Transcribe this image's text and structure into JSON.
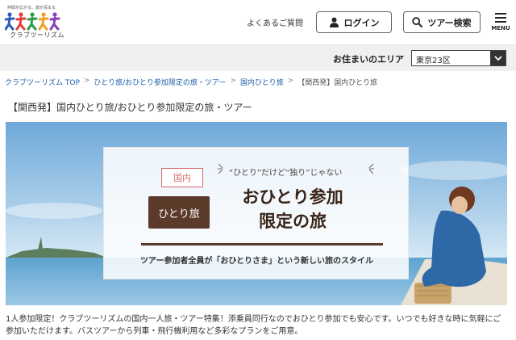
{
  "header": {
    "logo_tagline": "仲間が広がる、旅が深まる",
    "logo_name": "クラブツーリズム",
    "faq_label": "よくあるご質問",
    "login_label": "ログイン",
    "search_label": "ツアー検索",
    "menu_label": "MENU"
  },
  "area": {
    "label": "お住まいのエリア",
    "selected": "東京23区"
  },
  "breadcrumb": {
    "items": [
      "クラブツーリズム TOP",
      "ひとり旅/おひとり参加限定の旅・ツアー",
      "国内ひとり旅",
      "【関西発】国内ひとり旅"
    ],
    "separator": ">"
  },
  "page_title": "【関西発】国内ひとり旅/おひとり参加限定の旅・ツアー",
  "banner": {
    "badge_domestic": "国内",
    "badge_solo": "ひとり旅",
    "catchphrase": "“ひとり”だけど“独り”じゃない",
    "headline_line1": "おひとり参加",
    "headline_line2": "限定の旅",
    "subtitle": "ツアー参加者全員が「おひとりさま」という新しい旅のスタイル"
  },
  "description": "1人参加限定！クラブツーリズムの国内一人旅・ツアー特集！添乗員同行なのでおひとり参加でも安心です。いつでも好きな時に気軽にご参加いただけます。バスツアーから列車・飛行機利用など多彩なプランをご用意。",
  "colors": {
    "accent_brown": "#5b3a2a",
    "badge_red": "#d76b6b",
    "link_blue": "#1d5fa8",
    "sky_blue": "#7fb6df"
  },
  "icons": {
    "login": "user-icon",
    "search": "search-icon",
    "menu": "hamburger-icon",
    "select": "chevron-down-icon"
  }
}
